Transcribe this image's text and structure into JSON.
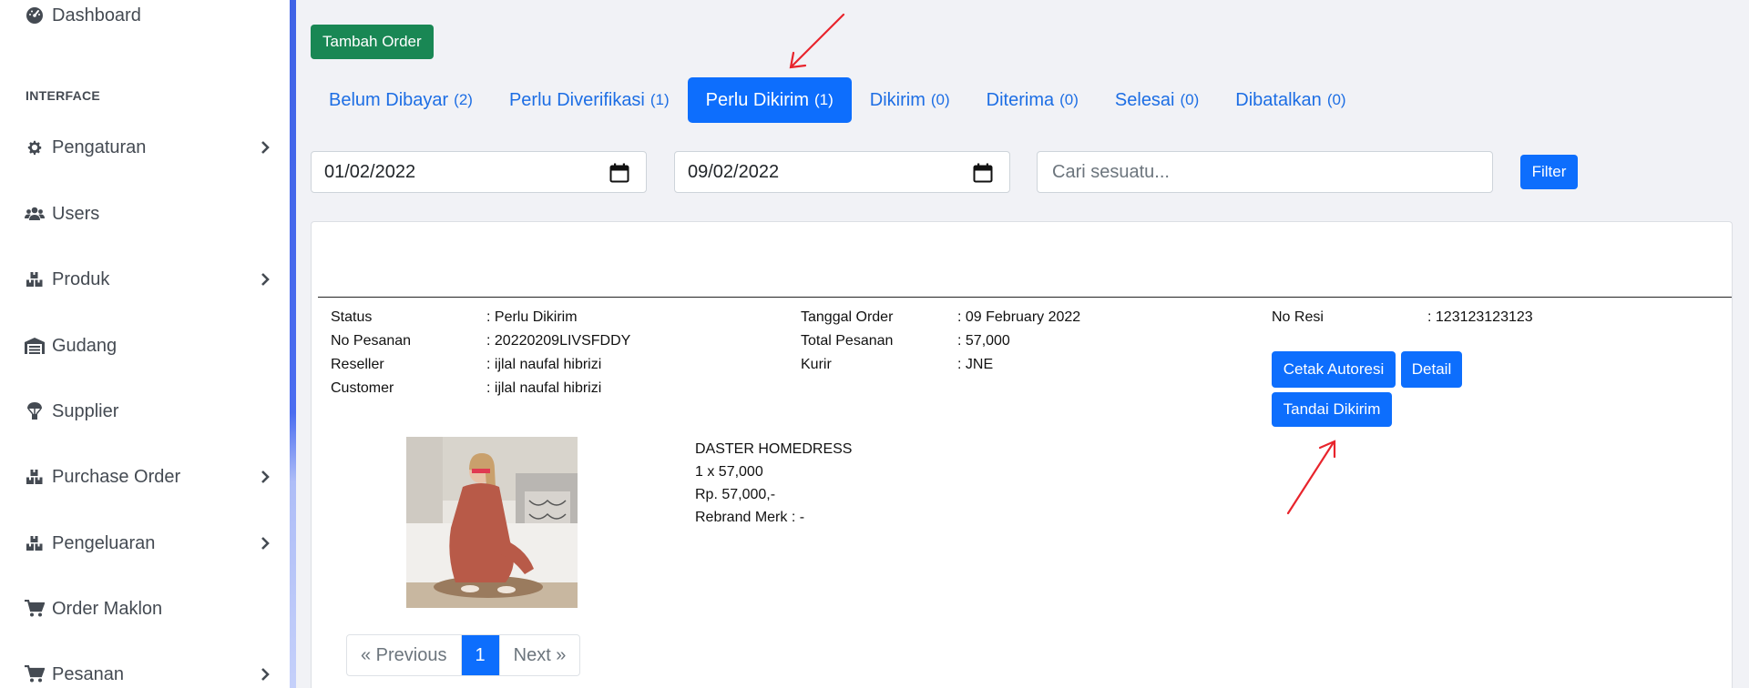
{
  "sidebar": {
    "dashboard": "Dashboard",
    "heading": "INTERFACE",
    "items": [
      {
        "label": "Pengaturan"
      },
      {
        "label": "Users"
      },
      {
        "label": "Produk"
      },
      {
        "label": "Gudang"
      },
      {
        "label": "Supplier"
      },
      {
        "label": "Purchase Order"
      },
      {
        "label": "Pengeluaran"
      },
      {
        "label": "Order Maklon"
      },
      {
        "label": "Pesanan"
      }
    ]
  },
  "toolbar": {
    "add_order": "Tambah Order"
  },
  "tabs": [
    {
      "label": "Belum Dibayar",
      "count": "(2)"
    },
    {
      "label": "Perlu Diverifikasi",
      "count": "(1)"
    },
    {
      "label": "Perlu Dikirim",
      "count": "(1)"
    },
    {
      "label": "Dikirim",
      "count": "(0)"
    },
    {
      "label": "Diterima",
      "count": "(0)"
    },
    {
      "label": "Selesai",
      "count": "(0)"
    },
    {
      "label": "Dibatalkan",
      "count": "(0)"
    }
  ],
  "filter": {
    "date_from": "01/02/2022",
    "date_to": "09/02/2022",
    "search_placeholder": "Cari sesuatu...",
    "filter_button": "Filter"
  },
  "order": {
    "col1": [
      {
        "key": "Status",
        "value": ": Perlu Dikirim"
      },
      {
        "key": "No Pesanan",
        "value": ": 20220209LIVSFDDY"
      },
      {
        "key": "Reseller",
        "value": ": ijlal naufal hibrizi"
      },
      {
        "key": "Customer",
        "value": ": ijlal naufal hibrizi"
      }
    ],
    "col2": [
      {
        "key": "Tanggal Order",
        "value": ": 09 February 2022"
      },
      {
        "key": "Total Pesanan",
        "value": ": 57,000"
      },
      {
        "key": "Kurir",
        "value": ": JNE"
      }
    ],
    "col3": [
      {
        "key": "No Resi",
        "value": ": 123123123123"
      }
    ],
    "actions": {
      "print": "Cetak Autoresi",
      "detail": "Detail",
      "mark_sent": "Tandai Dikirim"
    },
    "product": {
      "name": "DASTER HOMEDRESS",
      "qty": "1 x 57,000",
      "price": "Rp. 57,000,-",
      "rebrand": "Rebrand Merk : -"
    }
  },
  "pagination": {
    "prev": "« Previous",
    "current": "1",
    "next": "Next »"
  },
  "colors": {
    "primary": "#0d6efd",
    "success": "#198754",
    "annotation": "#e8242c"
  }
}
